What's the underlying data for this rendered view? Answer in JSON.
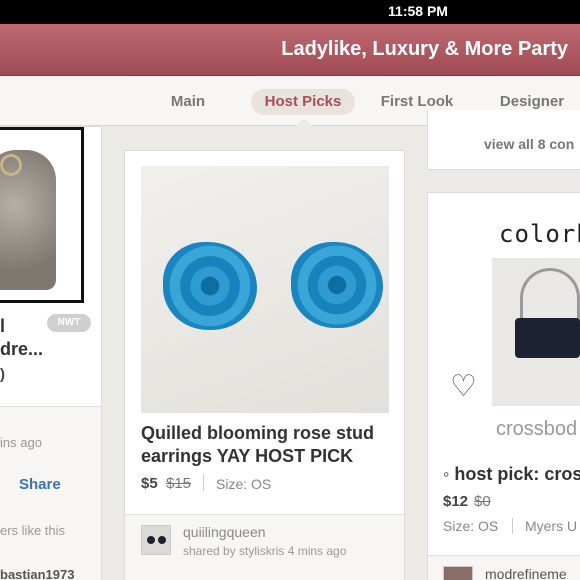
{
  "status_bar": {
    "time": "11:58 PM"
  },
  "header": {
    "title": "Ladylike, Luxury & More Party"
  },
  "tabs": [
    {
      "label": "Main",
      "active": false
    },
    {
      "label": "Host Picks",
      "active": true
    },
    {
      "label": "First Look",
      "active": false
    },
    {
      "label": "Designer",
      "active": false
    }
  ],
  "left_card": {
    "badge": "NWT",
    "title_line1": "l",
    "title_line2": "dre...",
    "price_fragment": ")",
    "time_ago": "ins ago",
    "share_label": "Share",
    "likes_text": "ers like this",
    "user": "bastian1973"
  },
  "middle_card": {
    "title_line1": "Quilled blooming rose stud",
    "title_line2": "earrings YAY HOST PICK",
    "price": "$5",
    "original_price": "$15",
    "size": "Size: OS",
    "seller": "quiilingqueen",
    "shared_by": "shared by styliskris 4 mins ago"
  },
  "right_top": {
    "view_all": "view all 8 con"
  },
  "right_card": {
    "brand_text": "colorb",
    "image_caption": "crossbod",
    "title": "◦ host pick: cros",
    "price": "$12",
    "original_price": "$0",
    "size": "Size: OS",
    "brand": "Myers U",
    "user": "modrefineme"
  },
  "colors": {
    "header": "#b05a62",
    "active_tab_text": "#a84e56",
    "link": "#3f73b5"
  }
}
